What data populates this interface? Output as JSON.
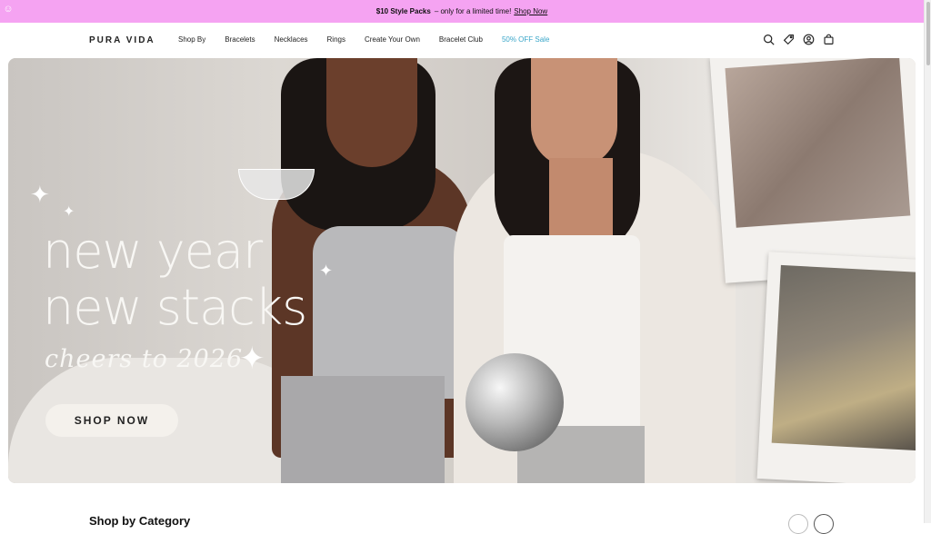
{
  "promo": {
    "highlight": "$10 Style Packs",
    "text": "– only for a limited time!",
    "link": "Shop Now",
    "bg_color": "#f5a3f2"
  },
  "accessibility_icon": "accessibility-icon",
  "header": {
    "logo": "PURA VIDA",
    "nav": [
      {
        "label": "Shop By"
      },
      {
        "label": "Bracelets"
      },
      {
        "label": "Necklaces"
      },
      {
        "label": "Rings"
      },
      {
        "label": "Create Your Own"
      },
      {
        "label": "Bracelet Club"
      },
      {
        "label": "50% OFF Sale",
        "color": "#3aa6c9"
      }
    ],
    "icons": [
      "search-icon",
      "tag-icon",
      "account-icon",
      "cart-icon"
    ]
  },
  "hero": {
    "title_line1": "new year",
    "title_line2": "new stacks",
    "subtitle": "cheers to 2026",
    "cta": "SHOP NOW"
  },
  "section": {
    "title": "Shop by Category"
  }
}
